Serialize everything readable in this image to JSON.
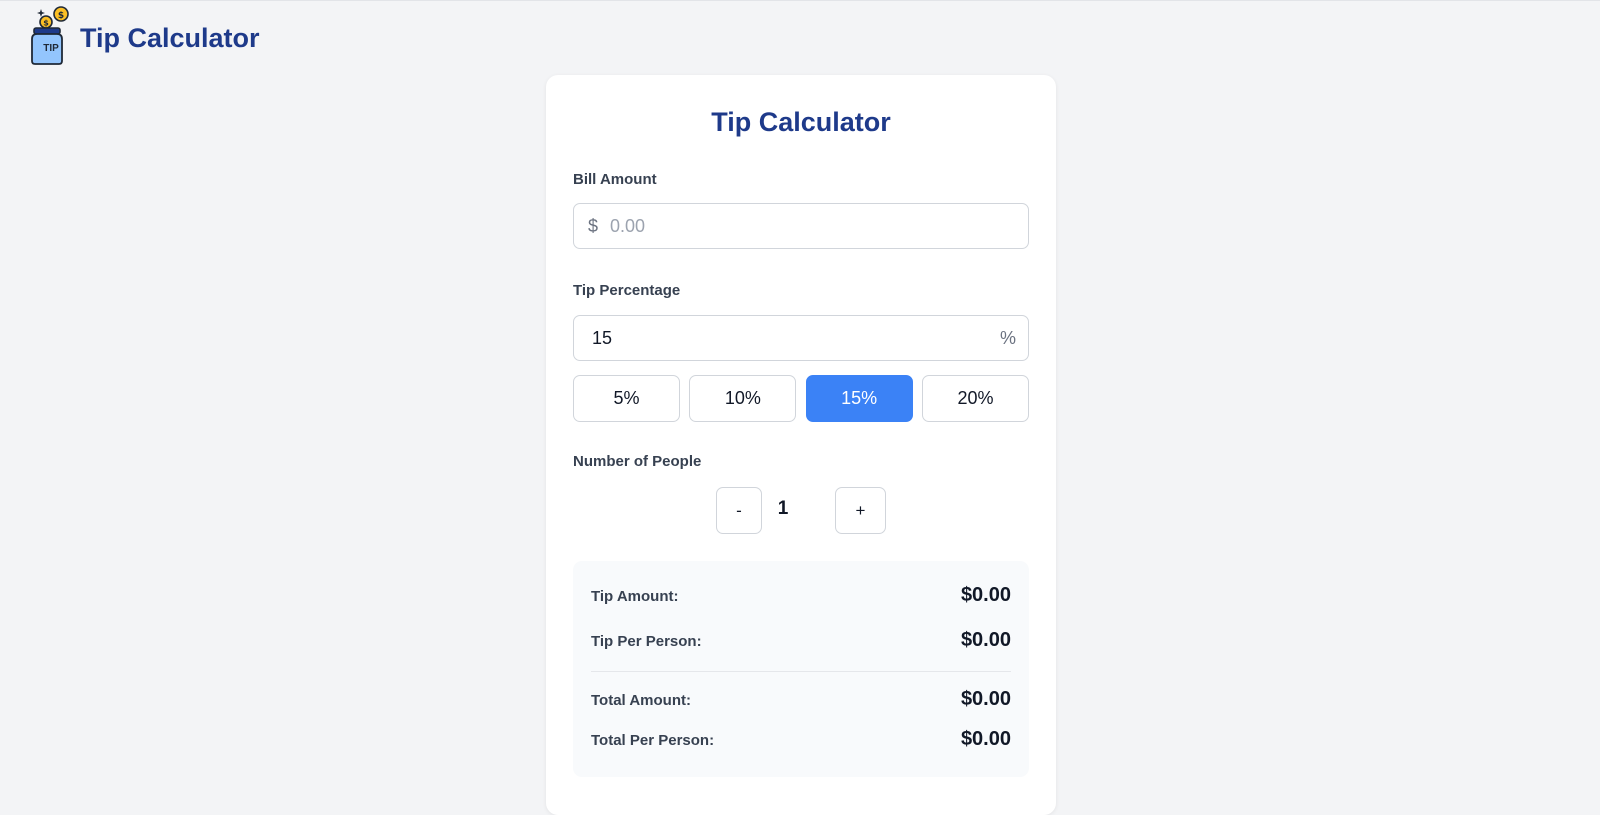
{
  "header": {
    "logo_text": "TIP",
    "title": "Tip Calculator"
  },
  "card": {
    "title": "Tip Calculator"
  },
  "bill": {
    "label": "Bill Amount",
    "prefix": "$",
    "placeholder": "0.00",
    "value": ""
  },
  "tip": {
    "label": "Tip Percentage",
    "value": "15",
    "suffix": "%",
    "presets": [
      {
        "label": "5%",
        "active": false
      },
      {
        "label": "10%",
        "active": false
      },
      {
        "label": "15%",
        "active": true
      },
      {
        "label": "20%",
        "active": false
      }
    ]
  },
  "people": {
    "label": "Number of People",
    "decrement_label": "-",
    "count": "1",
    "increment_label": "+"
  },
  "summary": {
    "tip_amount": {
      "label": "Tip Amount:",
      "value": "$0.00"
    },
    "tip_per_person": {
      "label": "Tip Per Person:",
      "value": "$0.00"
    },
    "total_amount": {
      "label": "Total Amount:",
      "value": "$0.00"
    },
    "total_per_person": {
      "label": "Total Per Person:",
      "value": "$0.00"
    }
  },
  "colors": {
    "brand": "#1e3a8a",
    "accent": "#3b82f6",
    "background": "#f3f4f6"
  }
}
